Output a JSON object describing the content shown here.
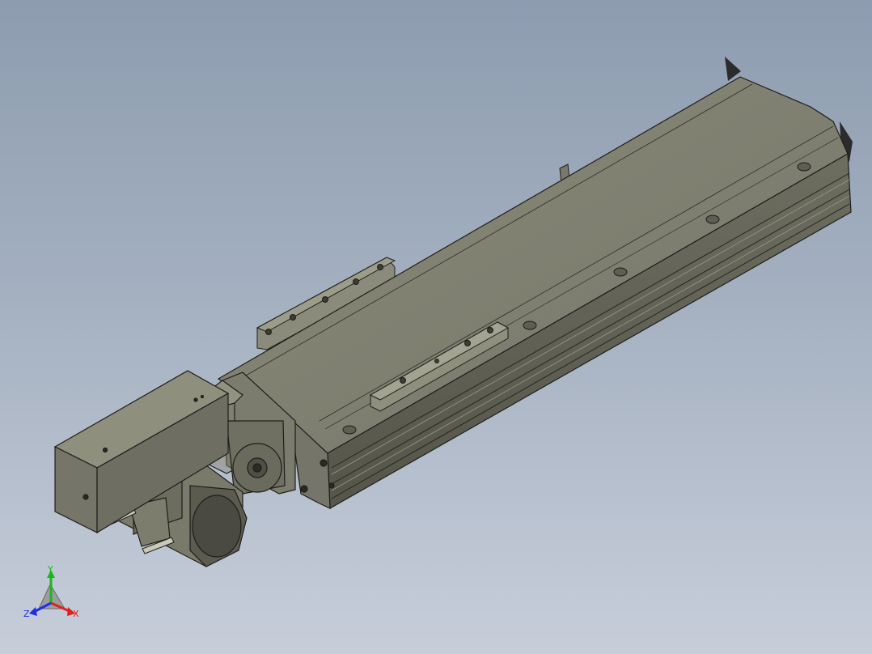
{
  "viewport": {
    "background_top": "#8d9cb0",
    "background_bottom": "#c7ceda"
  },
  "model": {
    "body_color": "#7f7f6f",
    "body_dark": "#5d5d50",
    "body_light": "#9a9a89",
    "edge_color": "#1e1e1a"
  },
  "triad": {
    "x_label": "X",
    "y_label": "Y",
    "z_label": "Z",
    "x_color": "#e0201c",
    "y_color": "#1fb41f",
    "z_color": "#2030e0"
  }
}
